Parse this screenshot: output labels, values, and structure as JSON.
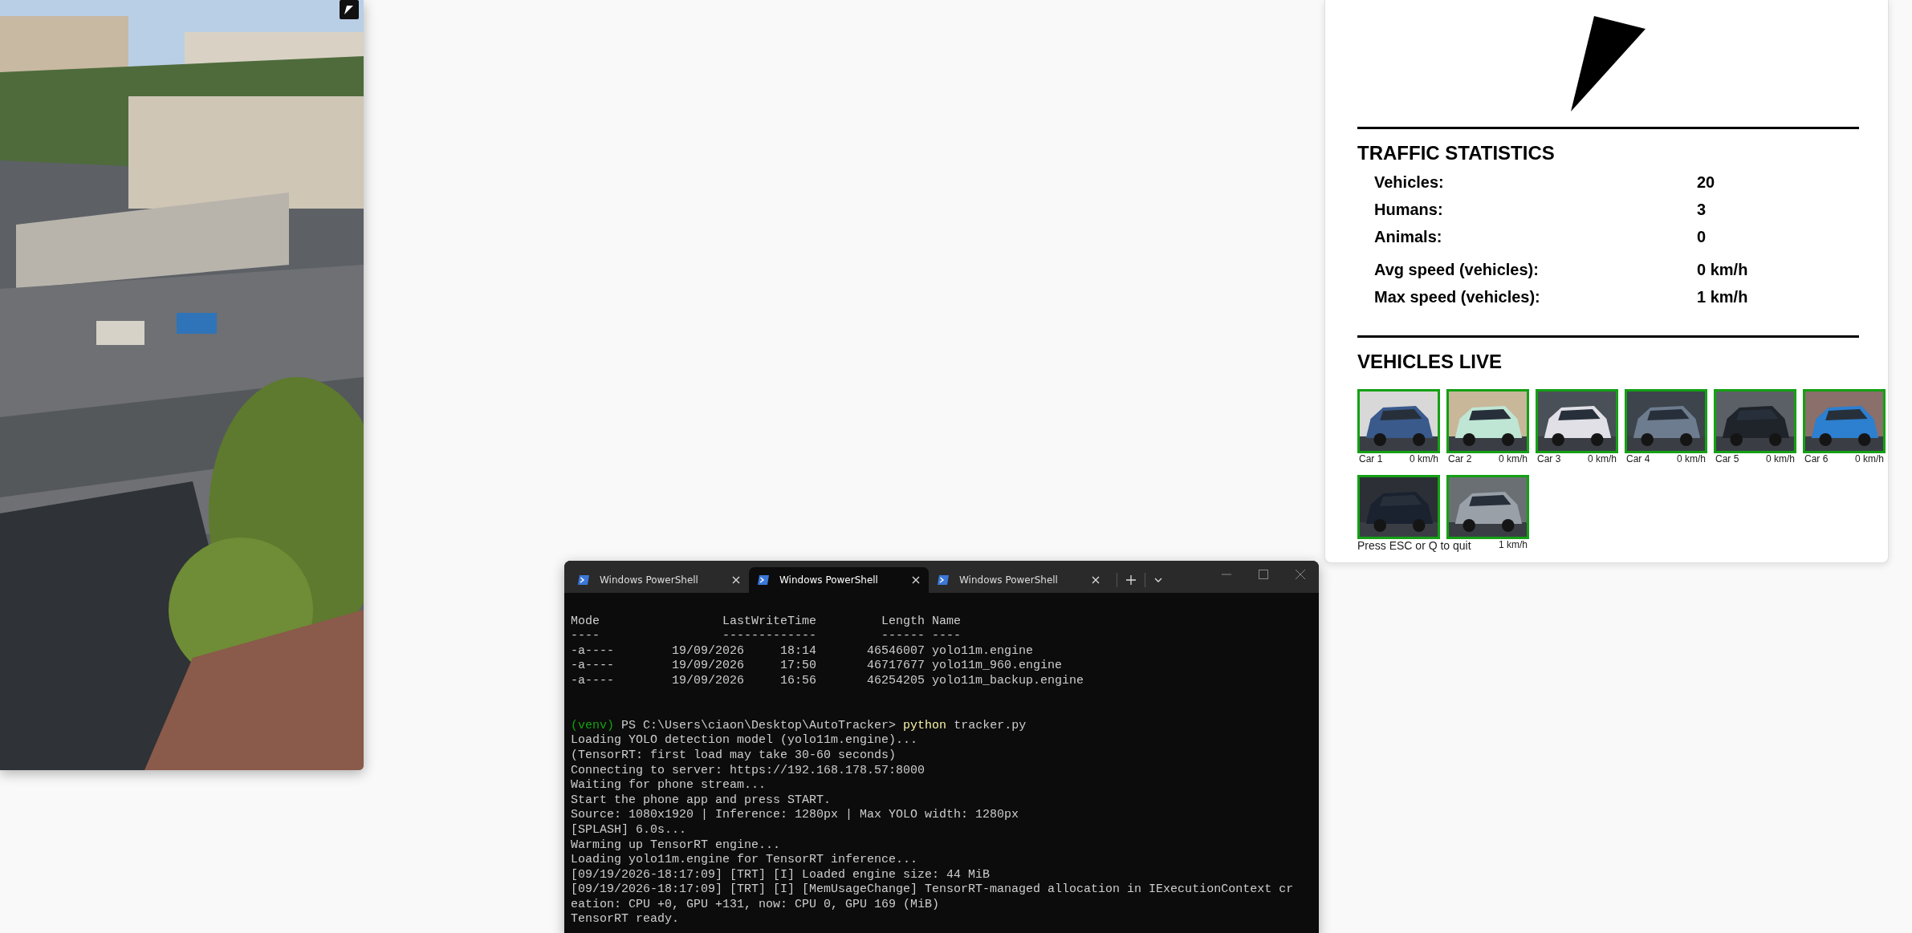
{
  "stats": {
    "title": "TRAFFIC STATISTICS",
    "counts": [
      {
        "label": "Vehicles:",
        "value": "20"
      },
      {
        "label": "Humans:",
        "value": "3"
      },
      {
        "label": "Animals:",
        "value": "0"
      }
    ],
    "speeds": [
      {
        "label": "Avg speed (vehicles):",
        "value": "0 km/h"
      },
      {
        "label": "Max speed (vehicles):",
        "value": "1 km/h"
      }
    ]
  },
  "vehicles": {
    "title": "VEHICLES LIVE",
    "items": [
      {
        "kind": "thumbnail",
        "label": "Car 1",
        "speed": "0 km/h"
      },
      {
        "kind": "thumbnail",
        "label": "Car 2",
        "speed": "0 km/h"
      },
      {
        "kind": "thumbnail",
        "label": "Car 3",
        "speed": "0 km/h"
      },
      {
        "kind": "thumbnail",
        "label": "Car 4",
        "speed": "0 km/h"
      },
      {
        "kind": "thumbnail",
        "label": "Car 5",
        "speed": "0 km/h"
      },
      {
        "kind": "thumbnail",
        "label": "Car 6",
        "speed": "0 km/h"
      },
      {
        "kind": "thumbnail"
      },
      {
        "kind": "thumbnail",
        "speed": "1 km/h"
      }
    ],
    "overlay": "Press ESC or Q to quit"
  },
  "terminal": {
    "tabs": [
      {
        "title": "Windows PowerShell",
        "selected": false
      },
      {
        "title": "Windows PowerShell",
        "selected": true
      },
      {
        "title": "Windows PowerShell",
        "selected": false
      }
    ],
    "lines": [
      {
        "kind": "blank"
      },
      {
        "kind": "plain",
        "text": "Mode                 LastWriteTime         Length Name"
      },
      {
        "kind": "plain",
        "text": "----                 -------------         ------ ----"
      },
      {
        "kind": "plain",
        "text": "-a----        19/09/2026     18:14       46546007 yolo11m.engine"
      },
      {
        "kind": "plain",
        "text": "-a----        19/09/2026     17:50       46717677 yolo11m_960.engine"
      },
      {
        "kind": "plain",
        "text": "-a----        19/09/2026     16:56       46254205 yolo11m_backup.engine"
      },
      {
        "kind": "blank"
      },
      {
        "kind": "blank"
      },
      {
        "kind": "prompt",
        "venv": "(venv)",
        "path": "PS C:\\Users\\ciaon\\Desktop\\AutoTracker>",
        "command": "python",
        "args": "tracker.py"
      },
      {
        "kind": "plain",
        "text": "Loading YOLO detection model (yolo11m.engine)..."
      },
      {
        "kind": "plain",
        "text": "(TensorRT: first load may take 30-60 seconds)"
      },
      {
        "kind": "plain",
        "text": "Connecting to server: https://192.168.178.57:8000"
      },
      {
        "kind": "plain",
        "text": "Waiting for phone stream..."
      },
      {
        "kind": "plain",
        "text": "Start the phone app and press START."
      },
      {
        "kind": "plain",
        "text": "Source: 1080x1920 | Inference: 1280px | Max YOLO width: 1280px"
      },
      {
        "kind": "plain",
        "text": "[SPLASH] 6.0s..."
      },
      {
        "kind": "plain",
        "text": "Warming up TensorRT engine..."
      },
      {
        "kind": "plain",
        "text": "Loading yolo11m.engine for TensorRT inference..."
      },
      {
        "kind": "plain",
        "text": "[09/19/2026-18:17:09] [TRT] [I] Loaded engine size: 44 MiB"
      },
      {
        "kind": "plain",
        "text": "[09/19/2026-18:17:09] [TRT] [I] [MemUsageChange] TensorRT-managed allocation in IExecutionContext cr"
      },
      {
        "kind": "plain",
        "text": "eation: CPU +0, GPU +131, now: CPU 0, GPU 169 (MiB)"
      },
      {
        "kind": "plain",
        "text": "TensorRT ready."
      }
    ]
  }
}
